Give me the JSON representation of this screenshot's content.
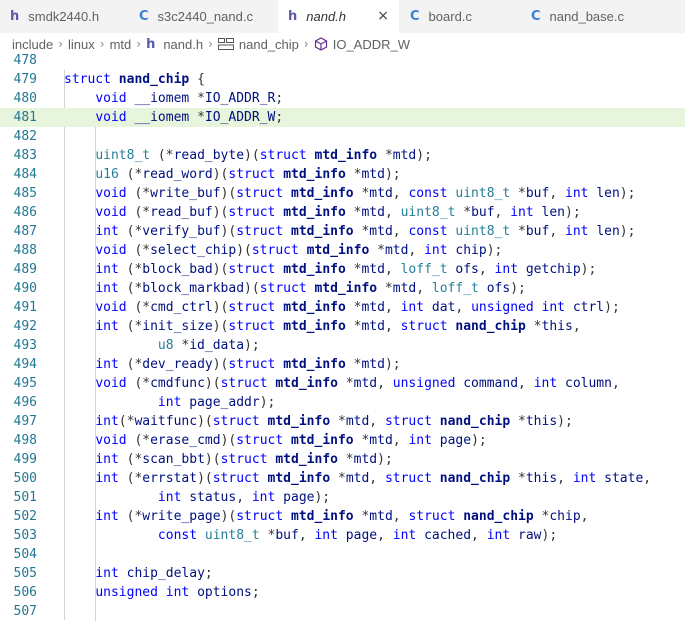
{
  "tabs": [
    {
      "icon": "h",
      "label": "smdk2440.h",
      "active": false
    },
    {
      "icon": "C",
      "label": "s3c2440_nand.c",
      "active": false
    },
    {
      "icon": "h",
      "label": "nand.h",
      "active": true,
      "close": "×"
    },
    {
      "icon": "C",
      "label": "board.c",
      "active": false
    },
    {
      "icon": "C",
      "label": "nand_base.c",
      "active": false
    }
  ],
  "breadcrumb": {
    "parts": [
      "include",
      "linux",
      "mtd"
    ],
    "separator": "›",
    "file_icon": "h",
    "file": "nand.h",
    "struct": "nand_chip",
    "field": "IO_ADDR_W"
  },
  "colors": {
    "keyword": "#0000ff",
    "type": "#267f99",
    "identifier": "#001080",
    "line_number": "#237893",
    "highlight": "#e8f5dd"
  },
  "code_lines": [
    {
      "n": "478",
      "t": ""
    },
    {
      "n": "479",
      "t": "struct nand_chip {"
    },
    {
      "n": "480",
      "t": "    void __iomem *IO_ADDR_R;"
    },
    {
      "n": "481",
      "t": "    void __iomem *IO_ADDR_W;",
      "hl": true
    },
    {
      "n": "482",
      "t": ""
    },
    {
      "n": "483",
      "t": "    uint8_t (*read_byte)(struct mtd_info *mtd);"
    },
    {
      "n": "484",
      "t": "    u16 (*read_word)(struct mtd_info *mtd);"
    },
    {
      "n": "485",
      "t": "    void (*write_buf)(struct mtd_info *mtd, const uint8_t *buf, int len);"
    },
    {
      "n": "486",
      "t": "    void (*read_buf)(struct mtd_info *mtd, uint8_t *buf, int len);"
    },
    {
      "n": "487",
      "t": "    int (*verify_buf)(struct mtd_info *mtd, const uint8_t *buf, int len);"
    },
    {
      "n": "488",
      "t": "    void (*select_chip)(struct mtd_info *mtd, int chip);"
    },
    {
      "n": "489",
      "t": "    int (*block_bad)(struct mtd_info *mtd, loff_t ofs, int getchip);"
    },
    {
      "n": "490",
      "t": "    int (*block_markbad)(struct mtd_info *mtd, loff_t ofs);"
    },
    {
      "n": "491",
      "t": "    void (*cmd_ctrl)(struct mtd_info *mtd, int dat, unsigned int ctrl);"
    },
    {
      "n": "492",
      "t": "    int (*init_size)(struct mtd_info *mtd, struct nand_chip *this,"
    },
    {
      "n": "493",
      "t": "            u8 *id_data);"
    },
    {
      "n": "494",
      "t": "    int (*dev_ready)(struct mtd_info *mtd);"
    },
    {
      "n": "495",
      "t": "    void (*cmdfunc)(struct mtd_info *mtd, unsigned command, int column,"
    },
    {
      "n": "496",
      "t": "            int page_addr);"
    },
    {
      "n": "497",
      "t": "    int(*waitfunc)(struct mtd_info *mtd, struct nand_chip *this);"
    },
    {
      "n": "498",
      "t": "    void (*erase_cmd)(struct mtd_info *mtd, int page);"
    },
    {
      "n": "499",
      "t": "    int (*scan_bbt)(struct mtd_info *mtd);"
    },
    {
      "n": "500",
      "t": "    int (*errstat)(struct mtd_info *mtd, struct nand_chip *this, int state,"
    },
    {
      "n": "501",
      "t": "            int status, int page);"
    },
    {
      "n": "502",
      "t": "    int (*write_page)(struct mtd_info *mtd, struct nand_chip *chip,"
    },
    {
      "n": "503",
      "t": "            const uint8_t *buf, int page, int cached, int raw);"
    },
    {
      "n": "504",
      "t": ""
    },
    {
      "n": "505",
      "t": "    int chip_delay;"
    },
    {
      "n": "506",
      "t": "    unsigned int options;"
    },
    {
      "n": "507",
      "t": ""
    }
  ]
}
